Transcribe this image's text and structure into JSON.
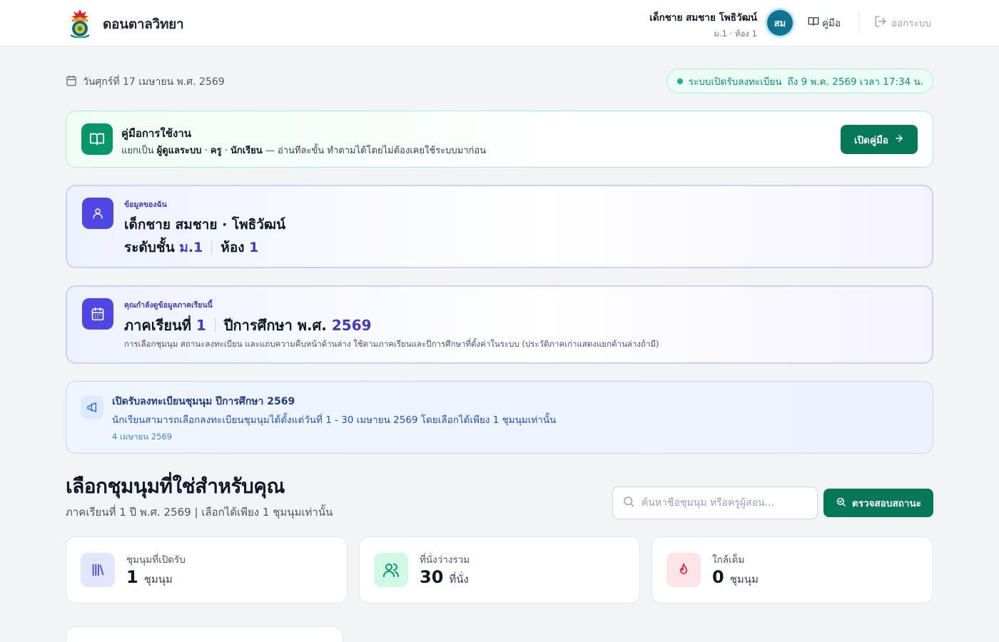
{
  "header": {
    "brand": "ดอนตาลวิทยา",
    "user_name": "เด็กชาย สมชาย โพธิวัฒน์",
    "user_class": "ม.1 · ห้อง 1",
    "avatar_initials": "สม",
    "manual_label": "คู่มือ",
    "logout_label": "ออกระบบ"
  },
  "date_text": "วันศุกร์ที่ 17 เมษายน พ.ศ. 2569",
  "status": {
    "text": "ระบบเปิดรับลงทะเบียน",
    "deadline": "ถึง 9 พ.ค. 2569 เวลา 17:34 น."
  },
  "manual_card": {
    "title": "คู่มือการใช้งาน",
    "desc_prefix": "แยกเป็น",
    "role_parents": "ผู้ดูแลระบบ",
    "dot1": "·",
    "role_teacher": "ครู",
    "dot2": "·",
    "role_student": "นักเรียน",
    "desc_suffix": "— อ่านทีละขั้น ทำตามได้โดยไม่ต้องเคยใช้ระบบมาก่อน",
    "button": "เปิดคู่มือ"
  },
  "profile": {
    "label": "ข้อมูลของฉัน",
    "name": "เด็กชาย สมชาย · โพธิวัฒน์",
    "level_label": "ระดับชั้น",
    "level": "ม.1",
    "room_label": "ห้อง",
    "room": "1"
  },
  "term": {
    "label": "คุณกำลังดูข้อมูลภาคเรียนนี้",
    "term_label": "ภาคเรียนที่",
    "term": "1",
    "year_label": "ปีการศึกษา พ.ศ.",
    "year": "2569",
    "note": "การเลือกชุมนุม สถานะลงทะเบียน และแถบความคืบหน้าด้านล่าง ใช้ตามภาคเรียนและปีการศึกษาที่ตั้งค่าในระบบ (ประวัติภาคเก่าแสดงแยกด้านล่างถ้ามี)"
  },
  "announcement": {
    "title": "เปิดรับลงทะเบียนชุมนุม ปีการศึกษา 2569",
    "body": "นักเรียนสามารถเลือกลงทะเบียนชุมนุมได้ตั้งแต่วันที่ 1 - 30 เมษายน 2569 โดยเลือกได้เพียง 1 ชุมนุมเท่านั้น",
    "date": "4 เมษายน 2569"
  },
  "section": {
    "title": "เลือกชุมนุมที่ใช่สำหรับคุณ",
    "subtitle": "ภาคเรียนที่ 1 ปี พ.ศ. 2569 | เลือกได้เพียง 1 ชุมนุมเท่านั้น",
    "search_placeholder": "ค้นหาชื่อชุมนุม หรือครูผู้สอน...",
    "check_button": "ตรวจสอบสถานะ"
  },
  "stats": [
    {
      "label": "ชุมนุมที่เปิดรับ",
      "value": "1",
      "unit": "ชุมนุม",
      "icon": "library-icon",
      "color": "#4f46e5",
      "bg": "#e0e7ff"
    },
    {
      "label": "ที่นั่งว่างรวม",
      "value": "30",
      "unit": "ที่นั่ง",
      "icon": "users-icon",
      "color": "#059669",
      "bg": "#d1fae5"
    },
    {
      "label": "ใกล้เต็ม",
      "value": "0",
      "unit": "ชุมนุม",
      "icon": "flame-icon",
      "color": "#e11d48",
      "bg": "#ffe4e6"
    }
  ],
  "colors": {
    "primary_green": "#047857",
    "indigo": "#4f46e5",
    "avatar": "#0e7490"
  }
}
